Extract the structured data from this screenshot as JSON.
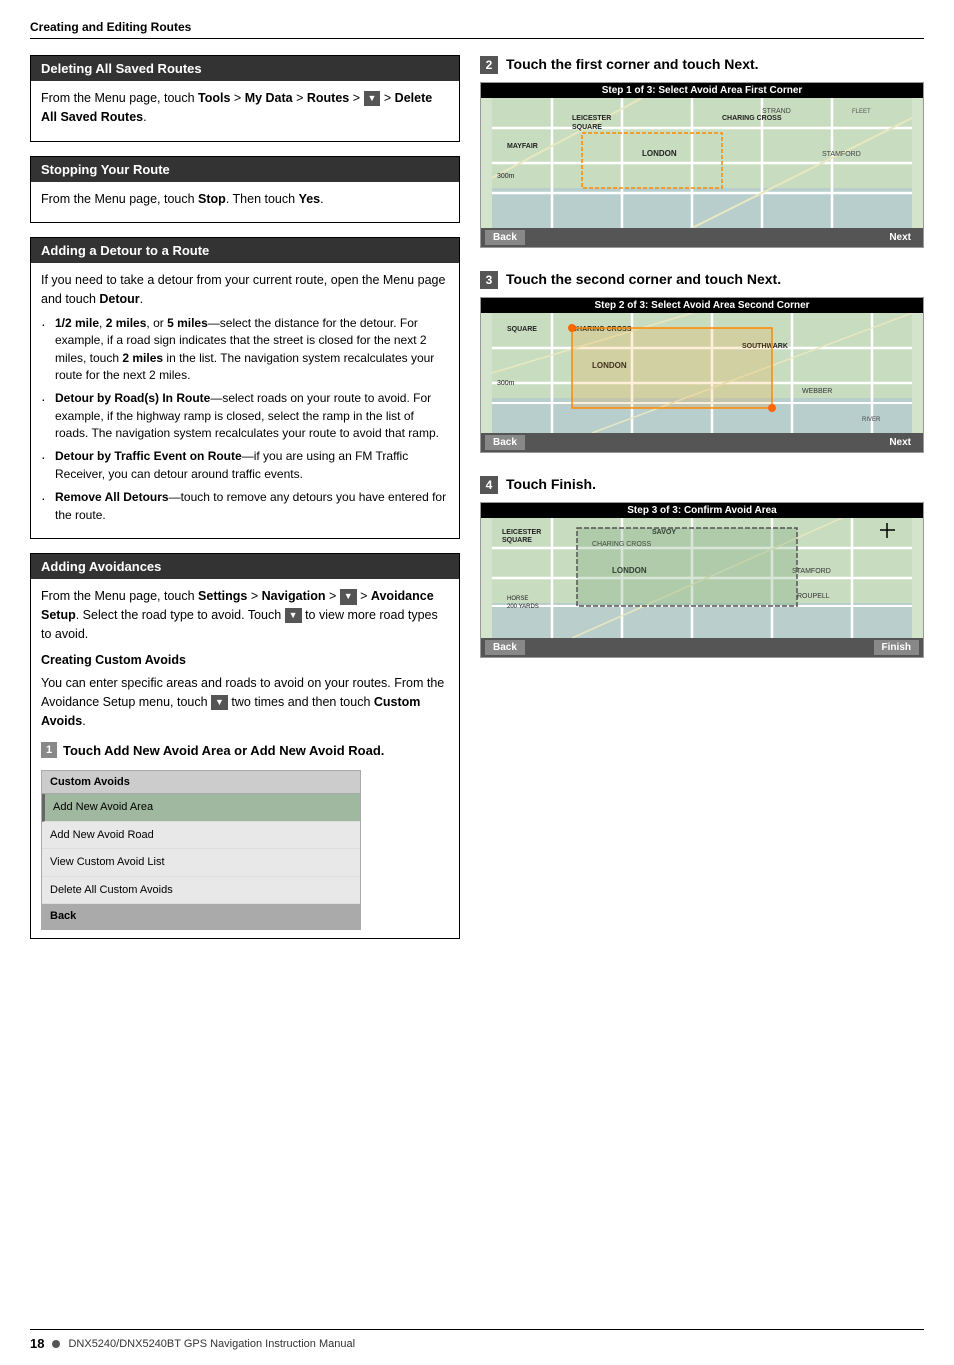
{
  "page": {
    "header": "Creating and Editing Routes",
    "footer": {
      "page_num": "18",
      "bullet": "●",
      "manual_title": "DNX5240/DNX5240BT GPS Navigation Instruction Manual"
    }
  },
  "left": {
    "sections": [
      {
        "id": "deleting",
        "title": "Deleting All Saved Routes",
        "body": "From the Menu page, touch Tools > My Data > Routes >",
        "body2": "> Delete All Saved Routes."
      },
      {
        "id": "stopping",
        "title": "Stopping Your Route",
        "body": "From the Menu page, touch Stop. Then touch Yes."
      },
      {
        "id": "detour",
        "title": "Adding a Detour to a Route",
        "intro": "If you need to take a detour from your current route, open the Menu page and touch Detour.",
        "bullets": [
          "1/2 mile, 2 miles, or 5 miles—select the distance for the detour. For example, if a road sign indicates that the street is closed for the next 2 miles, touch 2 miles in the list. The navigation system recalculates your route for the next 2 miles.",
          "Detour by Road(s) In Route—select roads on your route to avoid. For example, if the highway ramp is closed, select the ramp in the list of roads. The navigation system recalculates your route to avoid that ramp.",
          "Detour by Traffic Event on Route—if you are using an FM Traffic Receiver, you can detour around traffic events.",
          "Remove All Detours—touch to remove any detours you have entered for the route."
        ]
      },
      {
        "id": "avoidances",
        "title": "Adding Avoidances",
        "body1": "From the Menu page, touch Settings > Navigation >",
        "body1b": "> Avoidance Setup. Select the road type to avoid. Touch",
        "body1c": "to view more road types to avoid.",
        "subtitle": "Creating Custom Avoids",
        "body2": "You can enter specific areas and roads to avoid on your routes. From the Avoidance Setup menu, touch",
        "body2b": "two times and then touch Custom Avoids.",
        "step1": {
          "num": "1",
          "text": "Touch Add New Avoid Area or Add New Avoid Road."
        },
        "menu": {
          "title": "Custom Avoids",
          "items": [
            {
              "label": "Add New Avoid Area",
              "selected": true
            },
            {
              "label": "Add New Avoid Road",
              "selected": false
            },
            {
              "label": "View Custom Avoid List",
              "selected": false
            },
            {
              "label": "Delete All Custom Avoids",
              "selected": false
            }
          ],
          "back_label": "Back"
        }
      }
    ]
  },
  "right": {
    "steps": [
      {
        "num": "2",
        "text": "Touch the first corner and touch Next.",
        "map": {
          "title": "Step 1 of 3: Select Avoid Area First Corner",
          "back_btn": "Back",
          "next_btn": "Next",
          "labels": [
            "LEICESTER SQUARE",
            "CHARING CROSS",
            "LONDON",
            "MAYFAIR",
            "STRAND",
            "STAMFORD"
          ]
        }
      },
      {
        "num": "3",
        "text": "Touch the second corner and touch Next.",
        "map": {
          "title": "Step 2 of 3: Select Avoid Area Second Corner",
          "back_btn": "Back",
          "next_btn": "Next",
          "labels": [
            "SQUARE",
            "CHARING CROSS",
            "LONDON",
            "SOUTHWARK",
            "WEBBER",
            "RIVER"
          ]
        }
      },
      {
        "num": "4",
        "text": "Touch Finish.",
        "map": {
          "title": "Step 3 of 3: Confirm Avoid Area",
          "back_btn": "Back",
          "finish_btn": "Finish",
          "labels": [
            "LEICESTER SQUARE",
            "SAVOY",
            "CHARING CROSS",
            "LONDON",
            "STAMFORD",
            "ROUPELL",
            "HORSE 200 YARDS"
          ]
        }
      }
    ]
  }
}
